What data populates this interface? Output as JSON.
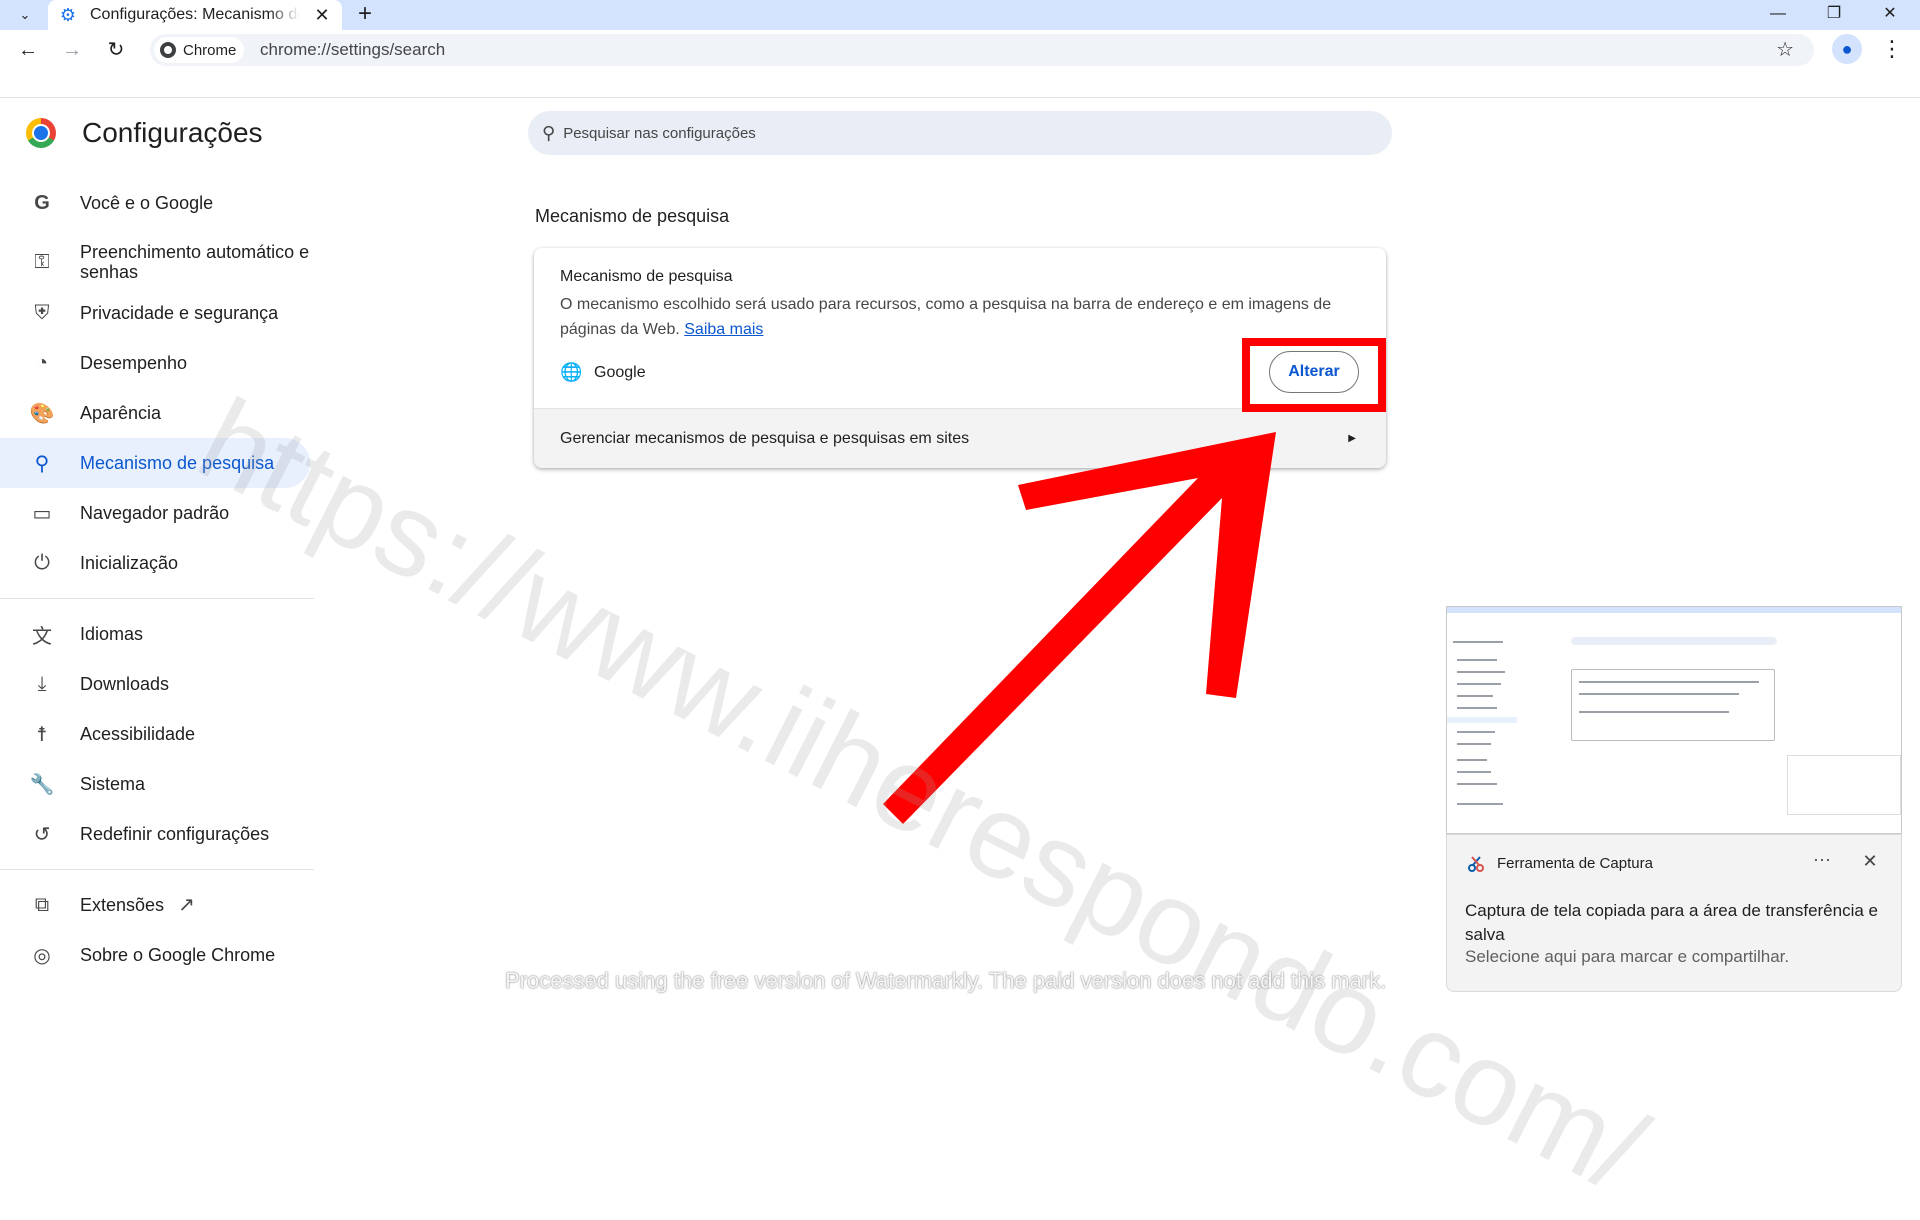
{
  "tab": {
    "title": "Configurações: Mecanismo de pesquisa"
  },
  "toolbar": {
    "chip_label": "Chrome",
    "url": "chrome://settings/search"
  },
  "sidebar": {
    "title": "Configurações",
    "items": [
      {
        "label": "Você e o Google",
        "icon": "google-g-icon"
      },
      {
        "label": "Preenchimento automático e senhas",
        "icon": "key-icon"
      },
      {
        "label": "Privacidade e segurança",
        "icon": "shield-icon"
      },
      {
        "label": "Desempenho",
        "icon": "speedometer-icon"
      },
      {
        "label": "Aparência",
        "icon": "palette-icon"
      },
      {
        "label": "Mecanismo de pesquisa",
        "icon": "search-icon",
        "active": true
      },
      {
        "label": "Navegador padrão",
        "icon": "browser-window-icon"
      },
      {
        "label": "Inicialização",
        "icon": "power-icon"
      },
      {
        "label": "Idiomas",
        "icon": "translate-icon"
      },
      {
        "label": "Downloads",
        "icon": "download-icon"
      },
      {
        "label": "Acessibilidade",
        "icon": "accessibility-icon"
      },
      {
        "label": "Sistema",
        "icon": "wrench-icon"
      },
      {
        "label": "Redefinir configurações",
        "icon": "reset-icon"
      },
      {
        "label": "Extensões",
        "icon": "puzzle-icon"
      },
      {
        "label": "Sobre o Google Chrome",
        "icon": "chrome-icon"
      }
    ]
  },
  "search": {
    "placeholder": "Pesquisar nas configurações"
  },
  "main": {
    "section_title": "Mecanismo de pesquisa",
    "card": {
      "heading": "Mecanismo de pesquisa",
      "description": "O mecanismo escolhido será usado para recursos, como a pesquisa na barra de endereço e em imagens de páginas da Web.",
      "learn_more": "Saiba mais",
      "engine_name": "Google",
      "change_button": "Alterar",
      "manage_label": "Gerenciar mecanismos de pesquisa e pesquisas em sites"
    }
  },
  "annotation": {
    "highlight_color": "#ff0000"
  },
  "watermark": {
    "url_text": "https://www.iiherespondo.com/",
    "note": "Processed using the free version of Watermarkly. The paid version does not add this mark."
  },
  "toast": {
    "app_name": "Ferramenta de Captura",
    "message": "Captura de tela copiada para a área de transferência e salva",
    "sub": "Selecione aqui para marcar e compartilhar."
  }
}
